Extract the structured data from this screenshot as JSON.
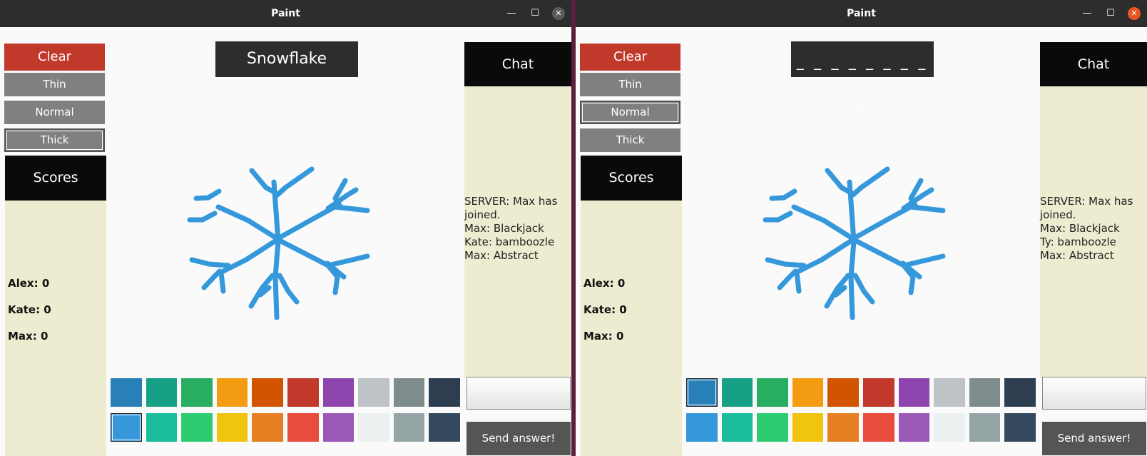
{
  "windows": [
    {
      "title": "Paint",
      "close_active": false,
      "tools": {
        "clear": "Clear",
        "thin": "Thin",
        "normal": "Normal",
        "thick": "Thick",
        "selected_size": "Thick"
      },
      "word": "Snowflake",
      "word_is_blank": false,
      "scores_title": "Scores",
      "scores": [
        "Alex: 0",
        "Kate: 0",
        "Max: 0"
      ],
      "chat_title": "Chat",
      "chat": [
        "SERVER: Max has joined.",
        "Max: Blackjack",
        "Kate: bamboozle",
        "Max: Abstract"
      ],
      "send_label": "Send answer!",
      "selected_color_index": 10
    },
    {
      "title": "Paint",
      "close_active": true,
      "tools": {
        "clear": "Clear",
        "thin": "Thin",
        "normal": "Normal",
        "thick": "Thick",
        "selected_size": "Normal"
      },
      "word": "_ _ _ _ _ _ _ _ _",
      "word_is_blank": true,
      "scores_title": "Scores",
      "scores": [
        "Alex: 0",
        "Kate: 0",
        "Max: 0"
      ],
      "chat_title": "Chat",
      "chat": [
        "SERVER: Max has joined.",
        "Max: Blackjack",
        "Ty: bamboozle",
        "Max: Abstract"
      ],
      "send_label": "Send answer!",
      "selected_color_index": 0
    }
  ],
  "palette": {
    "row1": [
      "#2980b9",
      "#16a085",
      "#27ae60",
      "#f39c12",
      "#d35400",
      "#c0392b",
      "#8e44ad",
      "#bdc3c7",
      "#7f8c8d",
      "#2c3e50"
    ],
    "row2": [
      "#3498db",
      "#1abc9c",
      "#2ecc71",
      "#f1c40f",
      "#e67e22",
      "#e74c3c",
      "#9b59b6",
      "#ecf0f1",
      "#95a5a6",
      "#34495e"
    ]
  },
  "drawing": {
    "stroke_color": "#3498db"
  },
  "colors": {
    "clear": "#c0392b",
    "tool_gray": "#808080",
    "panel_bg": "#edecd0",
    "header_bg": "#0a0a0a",
    "titlebar": "#2d2d2d",
    "close_active": "#e95420"
  }
}
